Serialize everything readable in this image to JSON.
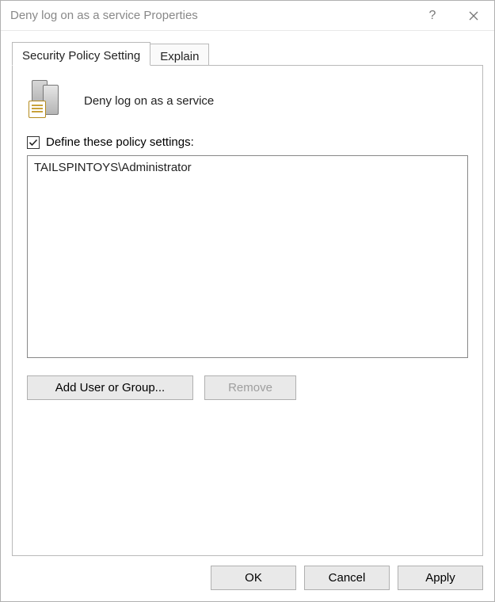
{
  "window": {
    "title": "Deny log on as a service Properties"
  },
  "tabs": {
    "security": "Security Policy Setting",
    "explain": "Explain"
  },
  "policy": {
    "title": "Deny log on as a service",
    "define_label": "Define these policy settings:",
    "define_checked": true
  },
  "list": {
    "items": [
      "TAILSPINTOYS\\Administrator"
    ]
  },
  "buttons": {
    "add": "Add User or Group...",
    "remove": "Remove",
    "ok": "OK",
    "cancel": "Cancel",
    "apply": "Apply"
  }
}
